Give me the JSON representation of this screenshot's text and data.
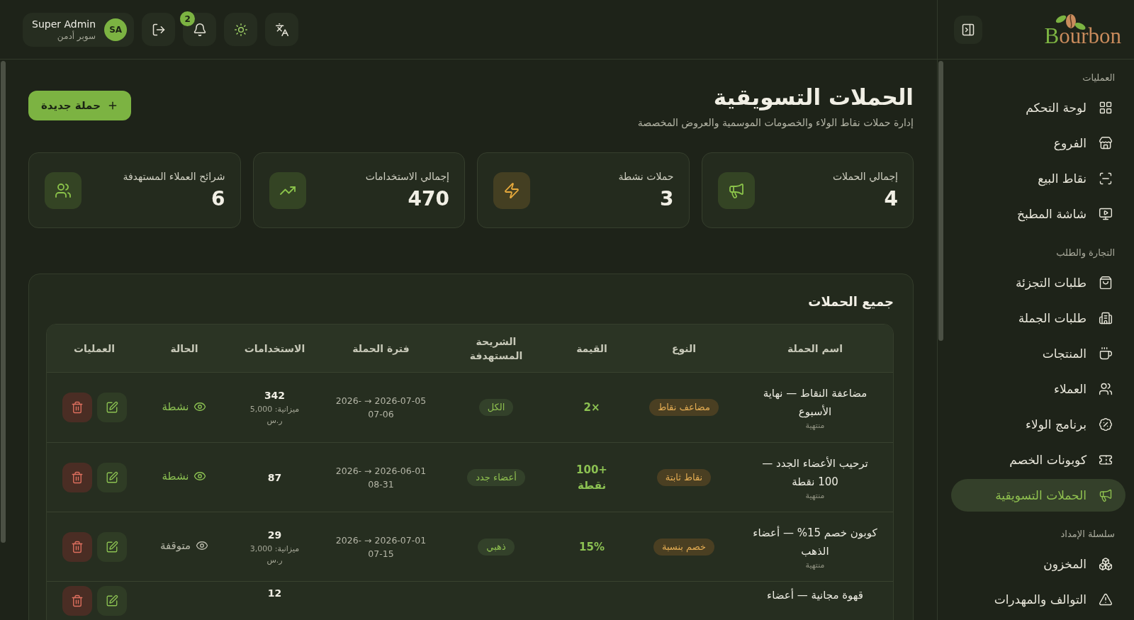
{
  "topbar": {
    "user": {
      "name": "Super Admin",
      "role": "سوبر أدمن",
      "initials": "SA"
    },
    "notifications": "2"
  },
  "sidebar": {
    "logo": "Bourbon",
    "sections": [
      {
        "title": "العمليات",
        "items": [
          {
            "label": "لوحة التحكم",
            "selected": false
          },
          {
            "label": "الفروع",
            "selected": false
          },
          {
            "label": "نقاط البيع",
            "selected": false
          },
          {
            "label": "شاشة المطبخ",
            "selected": false
          }
        ]
      },
      {
        "title": "التجارة والطلب",
        "items": [
          {
            "label": "طلبات التجزئة",
            "selected": false
          },
          {
            "label": "طلبات الجملة",
            "selected": false
          },
          {
            "label": "المنتجات",
            "selected": false
          },
          {
            "label": "العملاء",
            "selected": false
          },
          {
            "label": "برنامج الولاء",
            "selected": false
          },
          {
            "label": "كوبونات الخصم",
            "selected": false
          },
          {
            "label": "الحملات التسويقية",
            "selected": true
          }
        ]
      },
      {
        "title": "سلسلة الإمداد",
        "items": [
          {
            "label": "المخزون",
            "selected": false
          },
          {
            "label": "التوالف والمهدرات",
            "selected": false
          }
        ]
      }
    ]
  },
  "page": {
    "title": "الحملات التسويقية",
    "subtitle": "إدارة حملات نقاط الولاء والخصومات الموسمية والعروض المخصصة",
    "new_button": "حملة جديدة"
  },
  "stats": [
    {
      "label": "إجمالي الحملات",
      "value": "4",
      "color": "#8bc34a"
    },
    {
      "label": "حملات نشطة",
      "value": "3",
      "color": "#e6a93c"
    },
    {
      "label": "إجمالي الاستخدامات",
      "value": "470",
      "color": "#8bc34a"
    },
    {
      "label": "شرائح العملاء المستهدفة",
      "value": "6",
      "color": "#8bc34a"
    }
  ],
  "table": {
    "title": "جميع الحملات",
    "columns": [
      "اسم الحملة",
      "النوع",
      "القيمة",
      "الشريحة المستهدفة",
      "فترة الحملة",
      "الاستخدامات",
      "الحالة",
      "العمليات"
    ],
    "rows": [
      {
        "name": "مضاعفة النقاط — نهاية الأسبوع",
        "state": "منتهية",
        "type": "مضاعف نقاط",
        "value": "×2",
        "segment": "الكل",
        "period": "2026-07-05 → 2026-07-06",
        "uses": "342",
        "budget": "ميزانية: 5,000 ر.س",
        "status": {
          "label": "نشطة",
          "active": true
        }
      },
      {
        "name": "ترحيب الأعضاء الجدد — 100 نقطة",
        "state": "منتهية",
        "type": "نقاط ثابتة",
        "value": "+100 نقطة",
        "segment": "أعضاء جدد",
        "period": "2026-06-01 → 2026-08-31",
        "uses": "87",
        "status": {
          "label": "نشطة",
          "active": true
        }
      },
      {
        "name": "كوبون خصم 15% — أعضاء الذهب",
        "state": "منتهية",
        "type": "خصم بنسبة",
        "value": "15%",
        "segment": "ذهبي",
        "period": "2026-07-01 → 2026-07-15",
        "uses": "29",
        "budget": "ميزانية: 3,000 ر.س",
        "status": {
          "label": "متوقفة",
          "active": false
        }
      },
      {
        "name": "قهوة مجانية — أعضاء",
        "uses": "12"
      }
    ]
  }
}
